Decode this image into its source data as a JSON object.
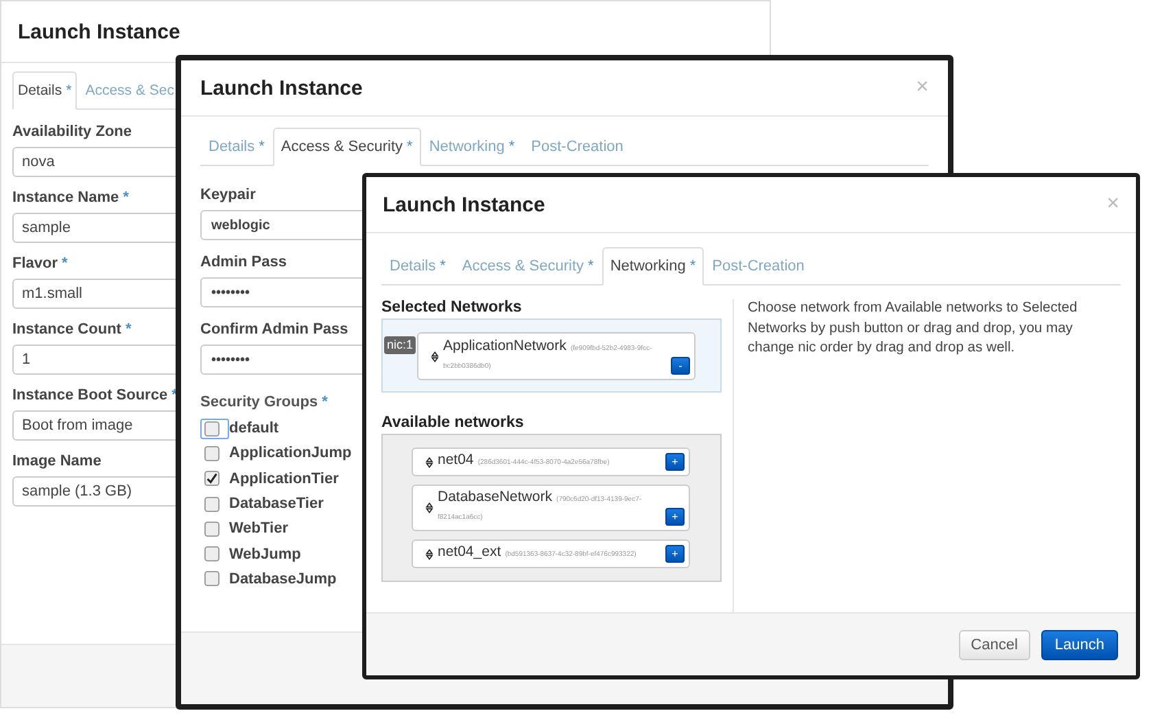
{
  "back_window": {
    "title": "Launch Instance",
    "tabs": [
      {
        "label": "Details",
        "mark": "*",
        "selected": true
      },
      {
        "label": "Access & Sec",
        "selected": false
      }
    ],
    "fields": [
      {
        "label": "Availability Zone",
        "value": "nova"
      },
      {
        "label": "Instance Name",
        "mark": "*",
        "value": "sample"
      },
      {
        "label": "Flavor",
        "mark": "*",
        "value": "m1.small"
      },
      {
        "label": "Instance Count",
        "mark": "*",
        "value": "1"
      },
      {
        "label": "Instance Boot Source",
        "mark": "*",
        "value": "Boot from image"
      },
      {
        "label": "Image Name",
        "value": "sample (1.3 GB)"
      }
    ]
  },
  "middle_window": {
    "title": "Launch Instance",
    "close": "×",
    "tabs": [
      {
        "label": "Details",
        "mark": "*",
        "selected": false
      },
      {
        "label": "Access & Security",
        "mark": "*",
        "selected": true
      },
      {
        "label": "Networking",
        "mark": "*",
        "selected": false
      },
      {
        "label": "Post-Creation",
        "selected": false
      }
    ],
    "fields": [
      {
        "label": "Keypair",
        "value": "weblogic"
      },
      {
        "label": "Admin Pass",
        "value": "••••••••"
      },
      {
        "label": "Confirm Admin Pass",
        "value": "••••••••"
      }
    ],
    "security_groups": {
      "label": "Security Groups",
      "mark": "*",
      "items": [
        {
          "label": "default",
          "checked": false,
          "focused": true
        },
        {
          "label": "ApplicationJump",
          "checked": false,
          "focused": false
        },
        {
          "label": "ApplicationTier",
          "checked": true,
          "focused": false
        },
        {
          "label": "DatabaseTier",
          "checked": false,
          "focused": false
        },
        {
          "label": "WebTier",
          "checked": false,
          "focused": false
        },
        {
          "label": "WebJump",
          "checked": false,
          "focused": false
        },
        {
          "label": "DatabaseJump",
          "checked": false,
          "focused": false
        }
      ]
    }
  },
  "front_window": {
    "title": "Launch Instance",
    "close": "×",
    "tabs": [
      {
        "label": "Details",
        "mark": "*",
        "selected": false
      },
      {
        "label": "Access & Security",
        "mark": "*",
        "selected": false
      },
      {
        "label": "Networking",
        "mark": "*",
        "selected": true
      },
      {
        "label": "Post-Creation",
        "selected": false
      }
    ],
    "selected_networks": {
      "title": "Selected Networks",
      "items": [
        {
          "nic": "nic:1",
          "name": "ApplicationNetwork",
          "id": "(fe909fbd-52b2-4983-9fcc-bc2bb0386db0)",
          "button": "-"
        }
      ]
    },
    "available_networks": {
      "title": "Available networks",
      "items": [
        {
          "name": "net04",
          "id": "(286d3601-444c-4f53-8070-4a2e56a78fbe)",
          "button": "+"
        },
        {
          "name": "DatabaseNetwork",
          "id": "(790c6d20-df13-4139-9ec7-f8214ac1a6cc)",
          "button": "+"
        },
        {
          "name": "net04_ext",
          "id": "(bd591363-8637-4c32-89bf-ef476c993322)",
          "button": "+"
        }
      ]
    },
    "help": "Choose network from Available networks to Selected Networks by push button or drag and drop, you may change nic order by drag and drop as well.",
    "buttons": [
      {
        "label": "Cancel",
        "kind": "default"
      },
      {
        "label": "Launch",
        "kind": "primary"
      }
    ]
  }
}
